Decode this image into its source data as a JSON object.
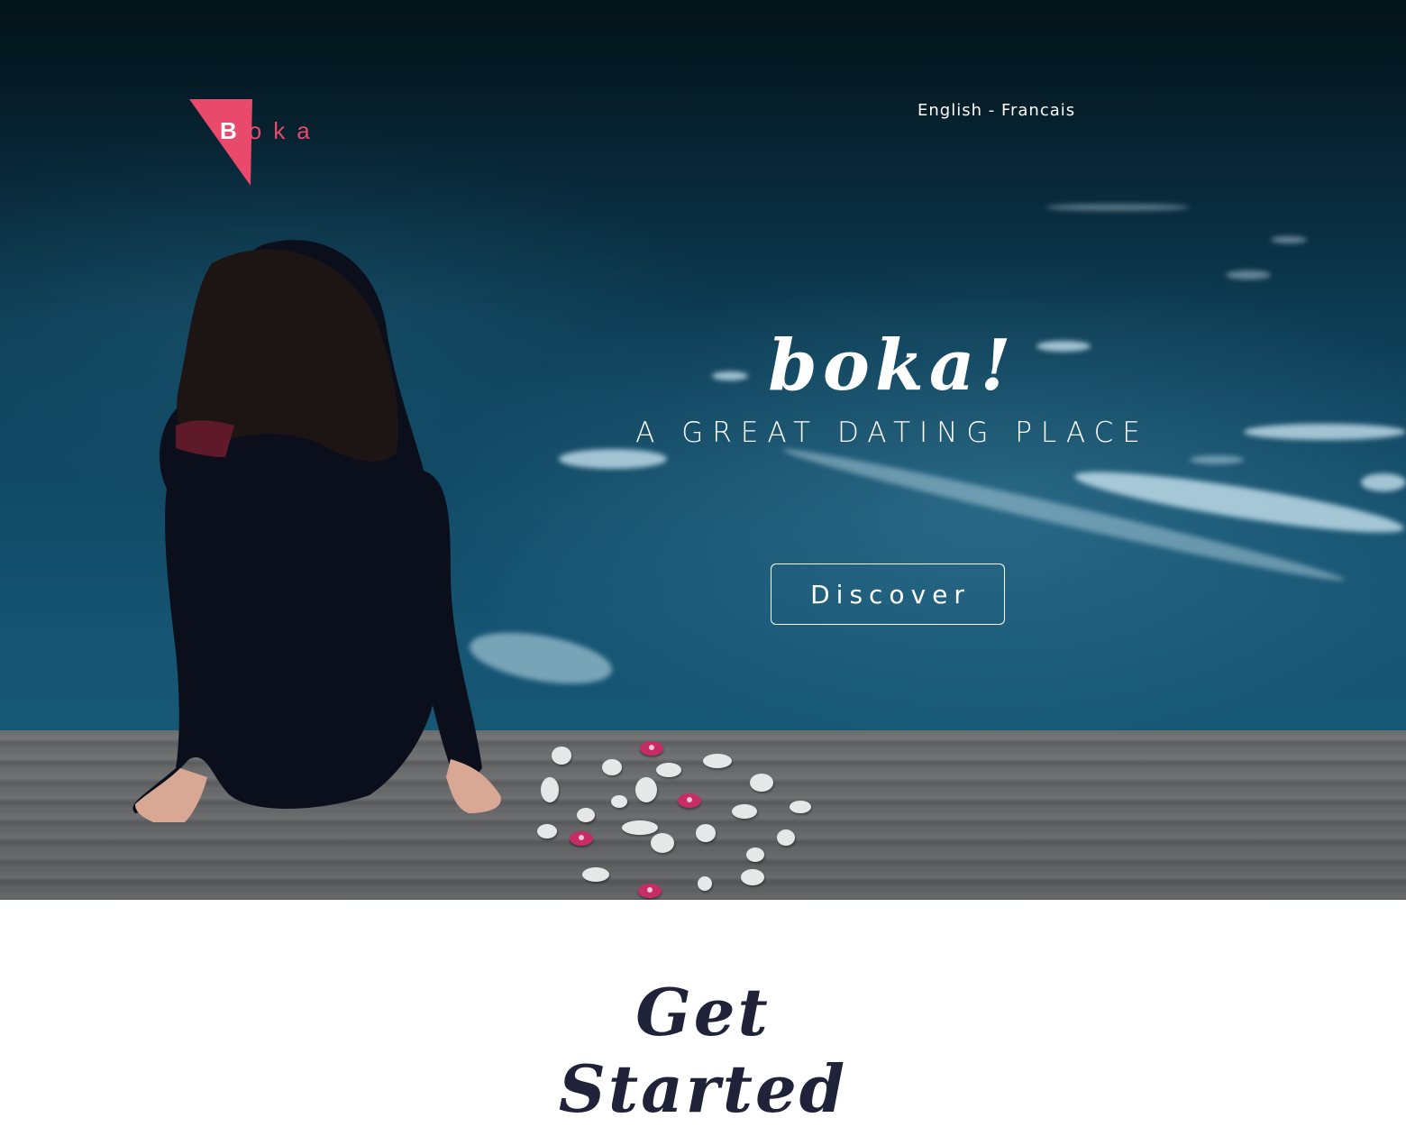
{
  "header": {
    "logo": {
      "first_letter": "B",
      "rest": "oka",
      "accent_color": "#e9496a"
    },
    "languages": [
      {
        "label": "English"
      },
      {
        "label": "- Francais"
      }
    ]
  },
  "hero": {
    "brand_title": "boka!",
    "tagline": "A GREAT DATING PLACE",
    "cta_label": "Discover"
  },
  "section": {
    "title": "Get Started",
    "title_color": "#1f2238"
  }
}
